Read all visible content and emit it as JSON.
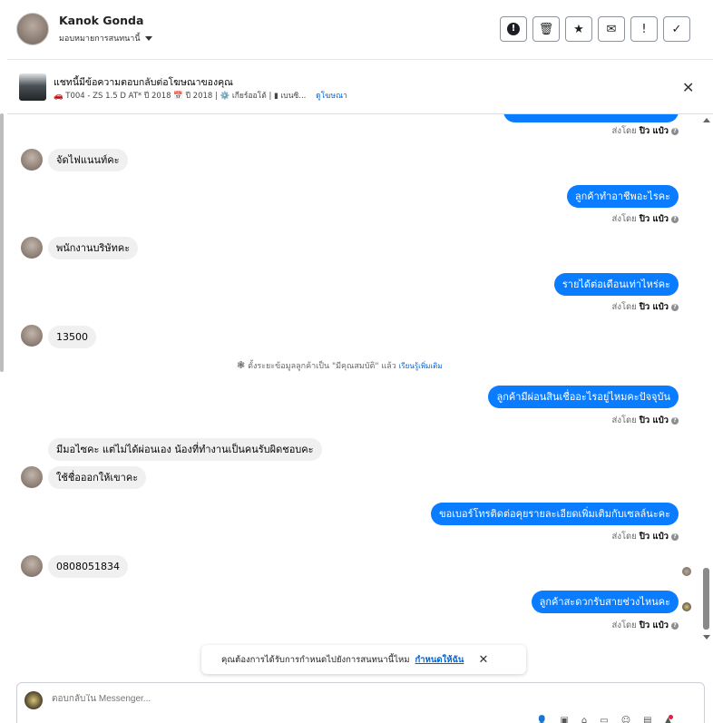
{
  "header": {
    "contact_name": "Kanok Gonda",
    "assign_label": "มอบหมายการสนทนานี้",
    "actions": [
      {
        "name": "spam-icon",
        "glyph": "!"
      },
      {
        "name": "trash-icon",
        "glyph": "🗑"
      },
      {
        "name": "star-icon",
        "glyph": "★"
      },
      {
        "name": "envelope-icon",
        "glyph": "✉"
      },
      {
        "name": "exclamation-icon",
        "glyph": "!"
      },
      {
        "name": "check-icon",
        "glyph": "✓"
      }
    ]
  },
  "ad_banner": {
    "title": "แชทนี้มีข้อความตอบกลับต่อโฆษณาของคุณ",
    "details": "🚗 T004 - ZS 1.5 D AT* ปี 2018 📅 ปี 2018 | ⚙️ เกียร์ออโต้ | ▮ เบนซิ...",
    "link": "ดูโฆษณา"
  },
  "messages": [
    {
      "dir": "out",
      "text": "",
      "sent_by": "ส่งโดย",
      "agent": "ปิว แป๋ว"
    },
    {
      "dir": "in",
      "text": "จัดไฟแนนท์คะ"
    },
    {
      "dir": "out",
      "text": "ลูกค้าทำอาชีพอะไรคะ",
      "sent_by": "ส่งโดย",
      "agent": "ปิว แป๋ว"
    },
    {
      "dir": "in",
      "text": "พนักงานบริษัทคะ"
    },
    {
      "dir": "out",
      "text": "รายได้ต่อเดือนเท่าไหร่คะ",
      "sent_by": "ส่งโดย",
      "agent": "ปิว แป๋ว"
    },
    {
      "dir": "in",
      "text": "13500"
    },
    {
      "dir": "system",
      "text": "ตั้งระยะข้อมูลลูกค้าเป็น \"มีคุณสมบัติ\" แล้ว",
      "link": "เรียนรู้เพิ่มเติม"
    },
    {
      "dir": "out",
      "text": "ลูกค้ามีผ่อนสินเชื่ออะไรอยู่ไหมคะปัจจุบัน",
      "sent_by": "ส่งโดย",
      "agent": "ปิว แป๋ว"
    },
    {
      "dir": "in",
      "text": "มีมอไซคะ แต่ไม่ได้ผ่อนเอง น้องที่ทำงานเป็นคนรับผิดชอบคะ"
    },
    {
      "dir": "in",
      "text": "ใช้ชื่อออกให้เขาคะ"
    },
    {
      "dir": "out",
      "text": "ขอเบอร์โทรติดต่อคุยรายละเอียดเพิ่มเติมกับเซลล์นะคะ",
      "sent_by": "ส่งโดย",
      "agent": "ปิว แป๋ว"
    },
    {
      "dir": "in",
      "text": "0808051834"
    },
    {
      "dir": "out",
      "text": "ลูกค้าสะดวกรับสายช่วงไหนคะ",
      "sent_by": "ส่งโดย",
      "agent": "ปิว แป๋ว"
    }
  ],
  "prompt": {
    "text": "คุณต้องการได้รับการกำหนดไปยังการสนทนานี้ไหม",
    "link": "กำหนดให้ฉัน"
  },
  "composer": {
    "placeholder": "ตอบกลับใน Messenger..."
  },
  "colors": {
    "outgoing_bubble": "#0a7cff",
    "incoming_bubble": "#f0f0f0",
    "link": "#0064d1"
  }
}
